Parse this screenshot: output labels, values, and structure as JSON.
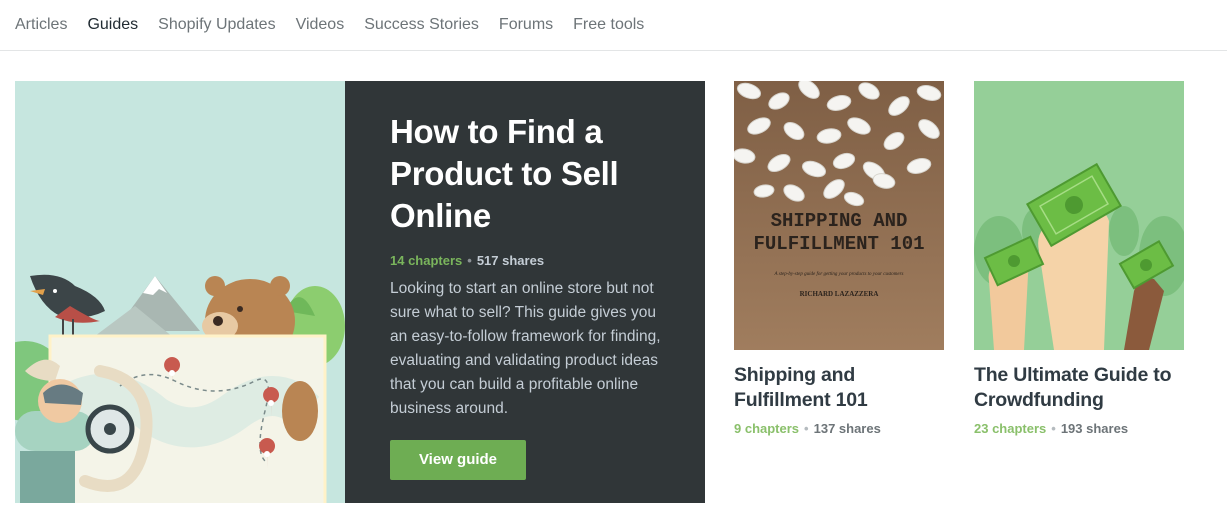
{
  "nav": {
    "items": [
      {
        "label": "Articles",
        "active": false
      },
      {
        "label": "Guides",
        "active": true
      },
      {
        "label": "Shopify Updates",
        "active": false
      },
      {
        "label": "Videos",
        "active": false
      },
      {
        "label": "Success Stories",
        "active": false
      },
      {
        "label": "Forums",
        "active": false
      },
      {
        "label": "Free tools",
        "active": false
      }
    ]
  },
  "hero": {
    "title": "How to Find a Product to Sell Online",
    "chapters": "14 chapters",
    "separator": "•",
    "shares": "517 shares",
    "description": "Looking to start an online store but not sure what to sell? This guide gives you an easy-to-follow framework for finding, evaluating and validating product ideas that you can build a profitable online business around.",
    "button_label": "View guide"
  },
  "cards": [
    {
      "title": "Shipping and Fulfillment 101",
      "chapters": "9 chapters",
      "separator": "•",
      "shares": "137 shares",
      "cover": {
        "heading_line1": "SHIPPING AND",
        "heading_line2": "FULFILLMENT 101",
        "subtitle": "A step-by-step guide for getting your products to your customers",
        "author": "RICHARD LAZAZZERA"
      }
    },
    {
      "title": "The Ultimate Guide to Crowdfunding",
      "chapters": "23 chapters",
      "separator": "•",
      "shares": "193 shares"
    }
  ],
  "colors": {
    "accent_green": "#6ead53",
    "hero_panel": "#303638",
    "hero_art_bg": "#c6e6df",
    "shipping_cover_bg": "#9a7659",
    "crowdfunding_cover_bg": "#95cf98"
  }
}
